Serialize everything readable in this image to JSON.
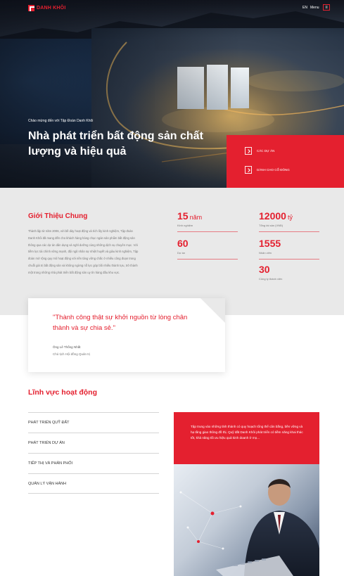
{
  "header": {
    "logo_text": "DANH KHÔI",
    "lang": "EN",
    "menu_label": "Menu",
    "menu_icon": "hamburger-icon"
  },
  "hero": {
    "greeting": "Chào mừng đến với Tập Đoàn Danh Khôi",
    "title": "Nhà phát triển bất động sản chất lượng và hiệu quả",
    "cta": [
      {
        "label": "CÁC DỰ ÁN",
        "icon": "arrow-right-icon"
      },
      {
        "label": "DÀNH CHO CỔ ĐÔNG",
        "icon": "arrow-right-icon"
      }
    ]
  },
  "intro": {
    "heading": "Giới Thiệu Chung",
    "text": "Thành lập từ năm 2006, với bề dày hoạt động và tích lũy kinh nghiệm, Tập đoàn Danh Khôi đã mang đến cho khách hàng hàng chục ngàn sản phẩm bất động sản thông qua các dự án dân dụng và nghỉ dưỡng cùng những dịch vụ chuyên mục. Với tiềm lực tài chính vững mạnh, đội ngũ nhân sự nhiệt huyết và giàu kinh nghiệm, Tập đoàn mở rộng quy mô hoạt động với nền tảng vững chắc ở nhiều công đoạn trong chuỗi giá trị bất động sản và không ngừng nỗ lực góp bồi nhiều thành tựu, trở thành một trong những nhà phát triển bất động sản uy tín hàng đầu khu vực.",
    "stats": [
      {
        "value": "15",
        "unit": "năm",
        "label": "Kinh nghiệm"
      },
      {
        "value": "12000",
        "unit": "tỷ",
        "label": "Tổng tài sản (VNĐ)"
      },
      {
        "value": "60",
        "unit": "",
        "label": "Dự án"
      },
      {
        "value": "1555",
        "unit": "",
        "label": "Nhân viên"
      },
      {
        "value": "30",
        "unit": "",
        "label": "Công ty thành viên"
      }
    ]
  },
  "quote": {
    "text": "\"Thành công thật sự khởi nguồn từ lòng chân thành và sự chia sẻ.\"",
    "author": "Ông Lê Thống Nhất",
    "role": "Chủ tịch Hội đồng Quản trị"
  },
  "activities": {
    "heading": "Lĩnh vực hoạt động",
    "items": [
      "PHÁT TRIỂN QUỸ ĐẤT",
      "PHÁT TRIỂN DỰ ÁN",
      "TIẾP THỊ VÀ PHÂN PHỐI",
      "QUẢN LÝ VẬN HÀNH"
    ],
    "description": "Tập trung vào những tỉnh thành có quy hoạch tổng thể cân bằng, bền vững và hạ tầng giao thông đồ thị. Quỹ đất Danh Khôi phát triển có tiềm năng khai thác tốt, khả năng tối ưu hiệu quả kinh doanh ở mọ..."
  },
  "colors": {
    "brand_red": "#e4202f",
    "light_gray": "#e9e9e9"
  }
}
